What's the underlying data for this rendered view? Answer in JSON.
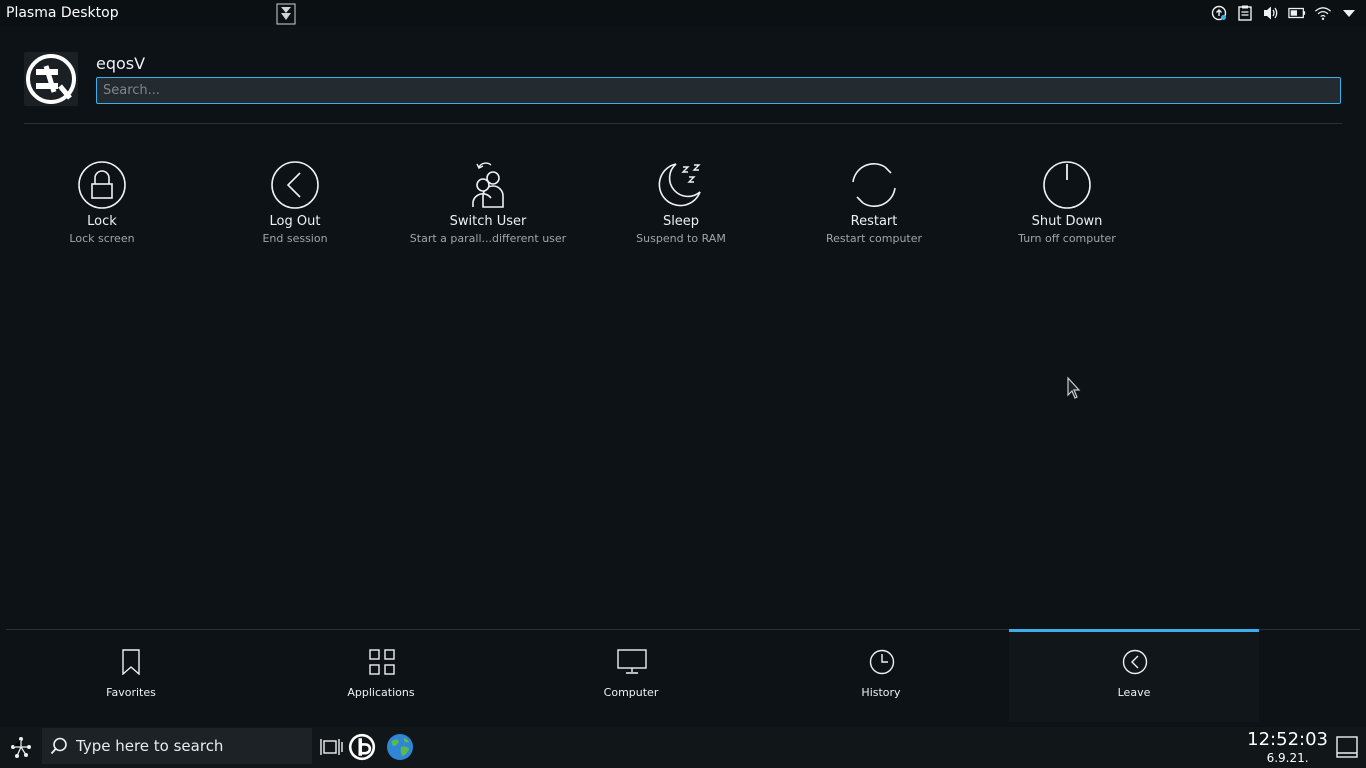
{
  "topbar": {
    "title": "Plasma Desktop"
  },
  "user": {
    "name": "eqosV"
  },
  "search": {
    "placeholder": "Search..."
  },
  "leave_items": [
    {
      "icon": "lock-icon",
      "label": "Lock",
      "sub": "Lock screen"
    },
    {
      "icon": "logout-icon",
      "label": "Log Out",
      "sub": "End session"
    },
    {
      "icon": "switch-user-icon",
      "label": "Switch User",
      "sub": "Start a parall...different user"
    },
    {
      "icon": "sleep-icon",
      "label": "Sleep",
      "sub": "Suspend to RAM"
    },
    {
      "icon": "restart-icon",
      "label": "Restart",
      "sub": "Restart computer"
    },
    {
      "icon": "power-icon",
      "label": "Shut Down",
      "sub": "Turn off computer"
    }
  ],
  "tabs": [
    {
      "icon": "bookmark-icon",
      "label": "Favorites",
      "active": false
    },
    {
      "icon": "grid-icon",
      "label": "Applications",
      "active": false
    },
    {
      "icon": "monitor-icon",
      "label": "Computer",
      "active": false
    },
    {
      "icon": "clock-icon",
      "label": "History",
      "active": false
    },
    {
      "icon": "leave-icon",
      "label": "Leave",
      "active": true
    }
  ],
  "taskbar": {
    "search_text": "Type here to search",
    "time": "12:52:03",
    "date": "6.9.21."
  },
  "colors": {
    "accent": "#3daee9",
    "background": "#0d1216",
    "panel": "#111618"
  }
}
